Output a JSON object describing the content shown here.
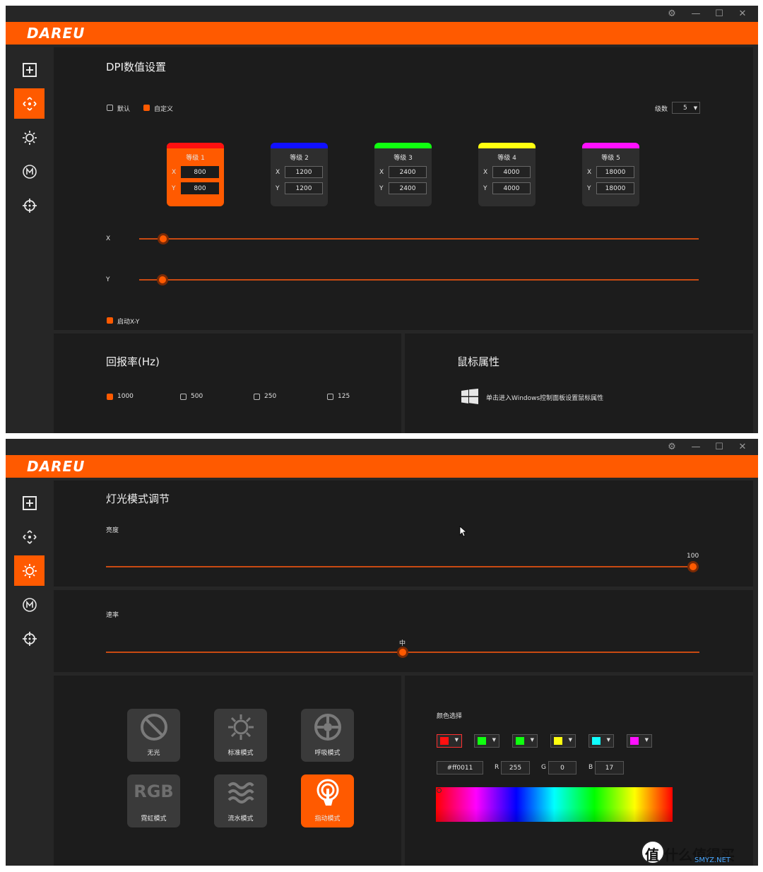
{
  "app": {
    "logo": "DAREU",
    "settings_icon": "gear-icon",
    "minimize": "—",
    "maximize": "☐",
    "close": "✕"
  },
  "colors": {
    "accent": "#ff5a00",
    "panel": "#1c1c1c",
    "chrome": "#262626"
  },
  "sidebar": [
    {
      "name": "macro",
      "icon": "plus-square-icon"
    },
    {
      "name": "dpi",
      "icon": "move-arrows-icon"
    },
    {
      "name": "lighting",
      "icon": "sun-icon"
    },
    {
      "name": "m-mode",
      "icon": "circle-m-icon"
    },
    {
      "name": "target",
      "icon": "crosshair-icon"
    }
  ],
  "dpi": {
    "title": "DPI数值设置",
    "default_label": "默认",
    "custom_label": "自定义",
    "levels_label": "级数",
    "levels_value": "5",
    "levels": [
      {
        "name": "等级 1",
        "x": "800",
        "y": "800",
        "color": "#ff1010"
      },
      {
        "name": "等级 2",
        "x": "1200",
        "y": "1200",
        "color": "#1010ff"
      },
      {
        "name": "等级 3",
        "x": "2400",
        "y": "2400",
        "color": "#10ff10"
      },
      {
        "name": "等级 4",
        "x": "4000",
        "y": "4000",
        "color": "#ffff10"
      },
      {
        "name": "等级 5",
        "x": "18000",
        "y": "18000",
        "color": "#ff10ff"
      }
    ],
    "x_label": "X",
    "y_label": "Y",
    "xy_toggle_label": "启动X-Y"
  },
  "report_rate": {
    "title": "回报率(Hz)",
    "options": [
      "1000",
      "500",
      "250",
      "125"
    ],
    "selected": "1000"
  },
  "mouse_props": {
    "title": "鼠标属性",
    "link_text": "单击进入Windows控制面板设置鼠标属性"
  },
  "lighting": {
    "title": "灯光模式调节",
    "brightness_label": "亮度",
    "brightness_value": "100",
    "speed_label": "速率",
    "speed_value": "中",
    "modes": [
      {
        "label": "无光",
        "icon": "no-light-icon"
      },
      {
        "label": "标准模式",
        "icon": "sun-icon"
      },
      {
        "label": "呼吸模式",
        "icon": "breath-icon"
      },
      {
        "label": "霓虹模式",
        "icon_text": "RGB"
      },
      {
        "label": "流水模式",
        "icon": "wave-icon"
      },
      {
        "label": "指动模式",
        "icon": "touch-icon"
      }
    ],
    "active_mode": "指动模式",
    "color_label": "颜色选择",
    "swatches": [
      "#ff1010",
      "#10ff10",
      "#10ff10",
      "#ffff10",
      "#10ffff",
      "#ff10ff"
    ],
    "hex_value": "#ff0011",
    "r_label": "R",
    "r_value": "255",
    "g_label": "G",
    "g_value": "0",
    "b_label": "B",
    "b_value": "17"
  },
  "watermark": {
    "text": "值 什么值得买",
    "sub": "SMYZ.NET"
  }
}
